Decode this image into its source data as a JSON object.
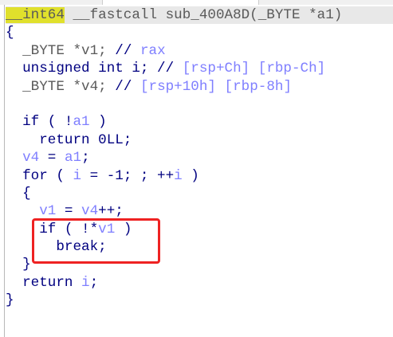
{
  "window": {
    "title": "Pseudocode"
  },
  "code_lines": [
    [
      {
        "t": "__int64",
        "c": "hl"
      },
      {
        "t": " __fastcall sub_400A8D(_BYTE *a1)",
        "c": "type"
      }
    ],
    [
      {
        "t": "{",
        "c": "plain"
      }
    ],
    [
      {
        "t": "  _BYTE *v1; ",
        "c": "type"
      },
      {
        "t": "// ",
        "c": "plain"
      },
      {
        "t": "rax",
        "c": "cmt"
      }
    ],
    [
      {
        "t": "  unsigned int i; ",
        "c": "kw"
      },
      {
        "t": "// ",
        "c": "plain"
      },
      {
        "t": "[rsp+Ch] [rbp-Ch]",
        "c": "cmt"
      }
    ],
    [
      {
        "t": "  _BYTE *v4; ",
        "c": "type"
      },
      {
        "t": "// ",
        "c": "plain"
      },
      {
        "t": "[rsp+10h] [rbp-8h]",
        "c": "cmt"
      }
    ],
    [
      {
        "t": "",
        "c": "plain"
      }
    ],
    [
      {
        "t": "  if ( !",
        "c": "kw"
      },
      {
        "t": "a1",
        "c": "var"
      },
      {
        "t": " )",
        "c": "kw"
      }
    ],
    [
      {
        "t": "    return 0LL;",
        "c": "kw"
      }
    ],
    [
      {
        "t": "  ",
        "c": "plain"
      },
      {
        "t": "v4",
        "c": "var"
      },
      {
        "t": " = ",
        "c": "plain"
      },
      {
        "t": "a1",
        "c": "var"
      },
      {
        "t": ";",
        "c": "plain"
      }
    ],
    [
      {
        "t": "  for ( ",
        "c": "kw"
      },
      {
        "t": "i",
        "c": "var"
      },
      {
        "t": " = -1; ; ++",
        "c": "kw"
      },
      {
        "t": "i",
        "c": "var"
      },
      {
        "t": " )",
        "c": "kw"
      }
    ],
    [
      {
        "t": "  {",
        "c": "plain"
      }
    ],
    [
      {
        "t": "    ",
        "c": "plain"
      },
      {
        "t": "v1",
        "c": "var"
      },
      {
        "t": " = ",
        "c": "plain"
      },
      {
        "t": "v4",
        "c": "var"
      },
      {
        "t": "++;",
        "c": "plain"
      }
    ],
    [
      {
        "t": "    if ( !*",
        "c": "kw"
      },
      {
        "t": "v1",
        "c": "var"
      },
      {
        "t": " )",
        "c": "kw"
      }
    ],
    [
      {
        "t": "      break;",
        "c": "kw"
      }
    ],
    [
      {
        "t": "  }",
        "c": "plain"
      }
    ],
    [
      {
        "t": "  return ",
        "c": "kw"
      },
      {
        "t": "i",
        "c": "var"
      },
      {
        "t": ";",
        "c": "plain"
      }
    ],
    [
      {
        "t": "}",
        "c": "plain"
      }
    ]
  ],
  "highlight": {
    "color": "#ee2222",
    "lines": [
      12,
      13
    ]
  }
}
